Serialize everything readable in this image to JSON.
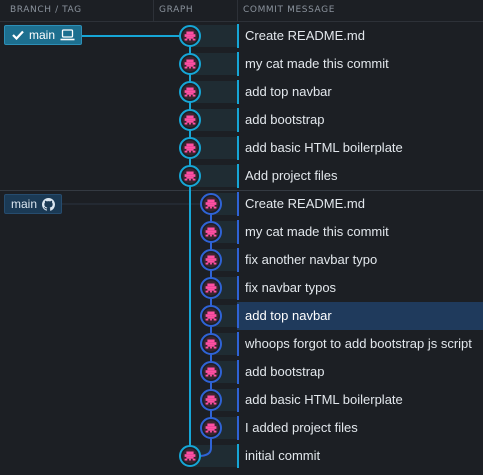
{
  "header": {
    "branch_tag": "BRANCH / TAG",
    "graph": "GRAPH",
    "commit_message": "COMMIT MESSAGE"
  },
  "branches": {
    "local": {
      "label": "main",
      "icon": "laptop-icon",
      "checked": true
    },
    "remote": {
      "label": "main",
      "icon": "github-icon"
    }
  },
  "colors": {
    "local_lane": "#16a6d6",
    "remote_lane": "#2f63d6",
    "node_fill": "#ff4fa3",
    "selected_row": "#1f3a5c"
  },
  "commits": [
    {
      "message": "Create README.md",
      "lane": "local"
    },
    {
      "message": "my cat made this commit",
      "lane": "local"
    },
    {
      "message": "add top navbar",
      "lane": "local"
    },
    {
      "message": "add bootstrap",
      "lane": "local"
    },
    {
      "message": "add basic HTML boilerplate",
      "lane": "local"
    },
    {
      "message": "Add project files",
      "lane": "local"
    },
    {
      "message": "Create README.md",
      "lane": "remote"
    },
    {
      "message": "my cat made this commit",
      "lane": "remote"
    },
    {
      "message": "fix another navbar typo",
      "lane": "remote"
    },
    {
      "message": "fix navbar typos",
      "lane": "remote"
    },
    {
      "message": "add top navbar",
      "lane": "remote",
      "selected": true
    },
    {
      "message": "whoops forgot to add bootstrap js script",
      "lane": "remote"
    },
    {
      "message": "add bootstrap",
      "lane": "remote"
    },
    {
      "message": "add basic HTML boilerplate",
      "lane": "remote"
    },
    {
      "message": "I added project files",
      "lane": "remote"
    },
    {
      "message": "initial commit",
      "lane": "base"
    }
  ]
}
